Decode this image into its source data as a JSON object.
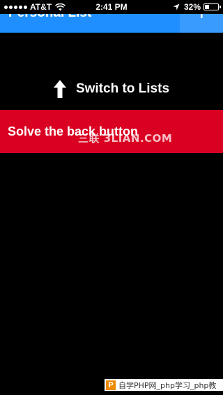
{
  "status_bar": {
    "carrier": "AT&T",
    "time": "2:41 PM",
    "battery_percent": "32%",
    "battery_level": 0.32,
    "signal_bars": 5
  },
  "header": {
    "title": "Personal List",
    "add_icon": "plus-icon",
    "color": "#1f8fff"
  },
  "switch_hint": {
    "label": "Switch to Lists",
    "icon": "up-arrow-icon"
  },
  "task": {
    "label": "Solve the back button",
    "color": "#d90021"
  },
  "watermark": {
    "text": "三联 3LIAN.COM"
  },
  "site_stamp": {
    "logo_letter": "P",
    "text": "自学PHP网_php学习_php教"
  }
}
